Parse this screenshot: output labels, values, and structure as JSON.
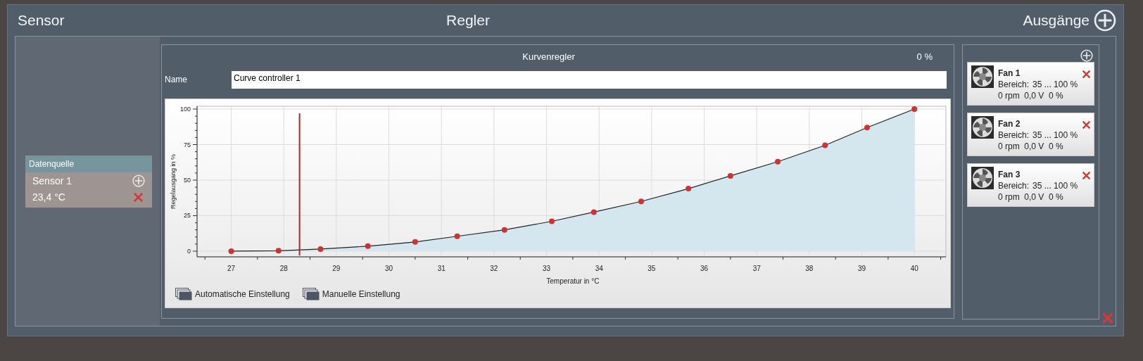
{
  "sections": {
    "sensor": "Sensor",
    "controller": "Regler",
    "outputs": "Ausgänge"
  },
  "datasource": {
    "title": "Datenquelle",
    "sensor": "Sensor 1",
    "value": "23,4 °C"
  },
  "controller": {
    "title": "Kurvenregler",
    "output": "0 %",
    "name_label": "Name",
    "name_value": "Curve controller 1",
    "chart_data": {
      "type": "area",
      "xlabel": "Temperatur in °C",
      "ylabel": "Regelausgang in %",
      "grid": true,
      "x": [
        27,
        27.9,
        28.7,
        29.6,
        30.5,
        31.3,
        32.2,
        33.1,
        33.9,
        34.8,
        35.7,
        36.5,
        37.4,
        38.3,
        39.1,
        40
      ],
      "series": [
        {
          "color": "#cc3333",
          "values": [
            0,
            0.3,
            1.5,
            3.5,
            6.5,
            10.5,
            15,
            21,
            27.5,
            35,
            44,
            53,
            63,
            74.5,
            87,
            100
          ]
        }
      ],
      "xlim": [
        26.35,
        40.6
      ],
      "ylim": [
        -4,
        102
      ],
      "xticks": [
        27,
        28,
        29,
        30,
        31,
        32,
        33,
        34,
        35,
        36,
        37,
        38,
        39,
        40
      ],
      "yticks": [
        0,
        25,
        50,
        75,
        100
      ],
      "ref_lines": [
        {
          "axis": "x",
          "value": 28.3,
          "color": "#a52a2a"
        }
      ]
    },
    "buttons": [
      "Automatische Einstellung",
      "Manuelle Einstellung"
    ]
  },
  "outputs": [
    {
      "name": "Fan 1",
      "range_label": "Bereich:",
      "range": "35 ... 100 %",
      "reading": "0 rpm  0,0 V  0 %"
    },
    {
      "name": "Fan 2",
      "range_label": "Bereich:",
      "range": "35 ... 100 %",
      "reading": "0 rpm  0,0 V  0 %"
    },
    {
      "name": "Fan 3",
      "range_label": "Bereich:",
      "range": "35 ... 100 %",
      "reading": "0 rpm  0,0 V  0 %"
    }
  ]
}
